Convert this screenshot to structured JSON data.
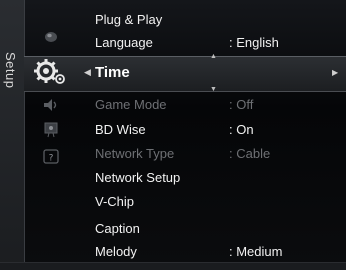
{
  "sidebar": {
    "label": "Setup"
  },
  "icons": {
    "picture": "picture-category-icon",
    "setup": "setup-gear-icon",
    "sound": "sound-category-icon",
    "channel": "channel-category-icon",
    "input": "input-category-icon"
  },
  "menu": {
    "items_above": [
      {
        "label": "Plug & Play",
        "value": ""
      },
      {
        "label": "Language",
        "value": ": English"
      }
    ],
    "selected": {
      "label": "Time",
      "value": ""
    },
    "items_below": [
      {
        "label": "Game Mode",
        "value": ": Off",
        "enabled": false
      },
      {
        "label": "BD Wise",
        "value": ": On",
        "enabled": true
      },
      {
        "label": "Network Type",
        "value": ": Cable",
        "enabled": false
      },
      {
        "label": "Network Setup",
        "value": "",
        "enabled": true
      },
      {
        "label": "V-Chip",
        "value": "",
        "enabled": true
      },
      {
        "label": "Caption",
        "value": "",
        "enabled": true
      },
      {
        "label": "Melody",
        "value": ": Medium",
        "enabled": true
      }
    ]
  },
  "colors": {
    "background": "#050608",
    "text": "#f2f2f2",
    "disabled_text": "#6e7074",
    "highlight": "#2c2f33"
  }
}
